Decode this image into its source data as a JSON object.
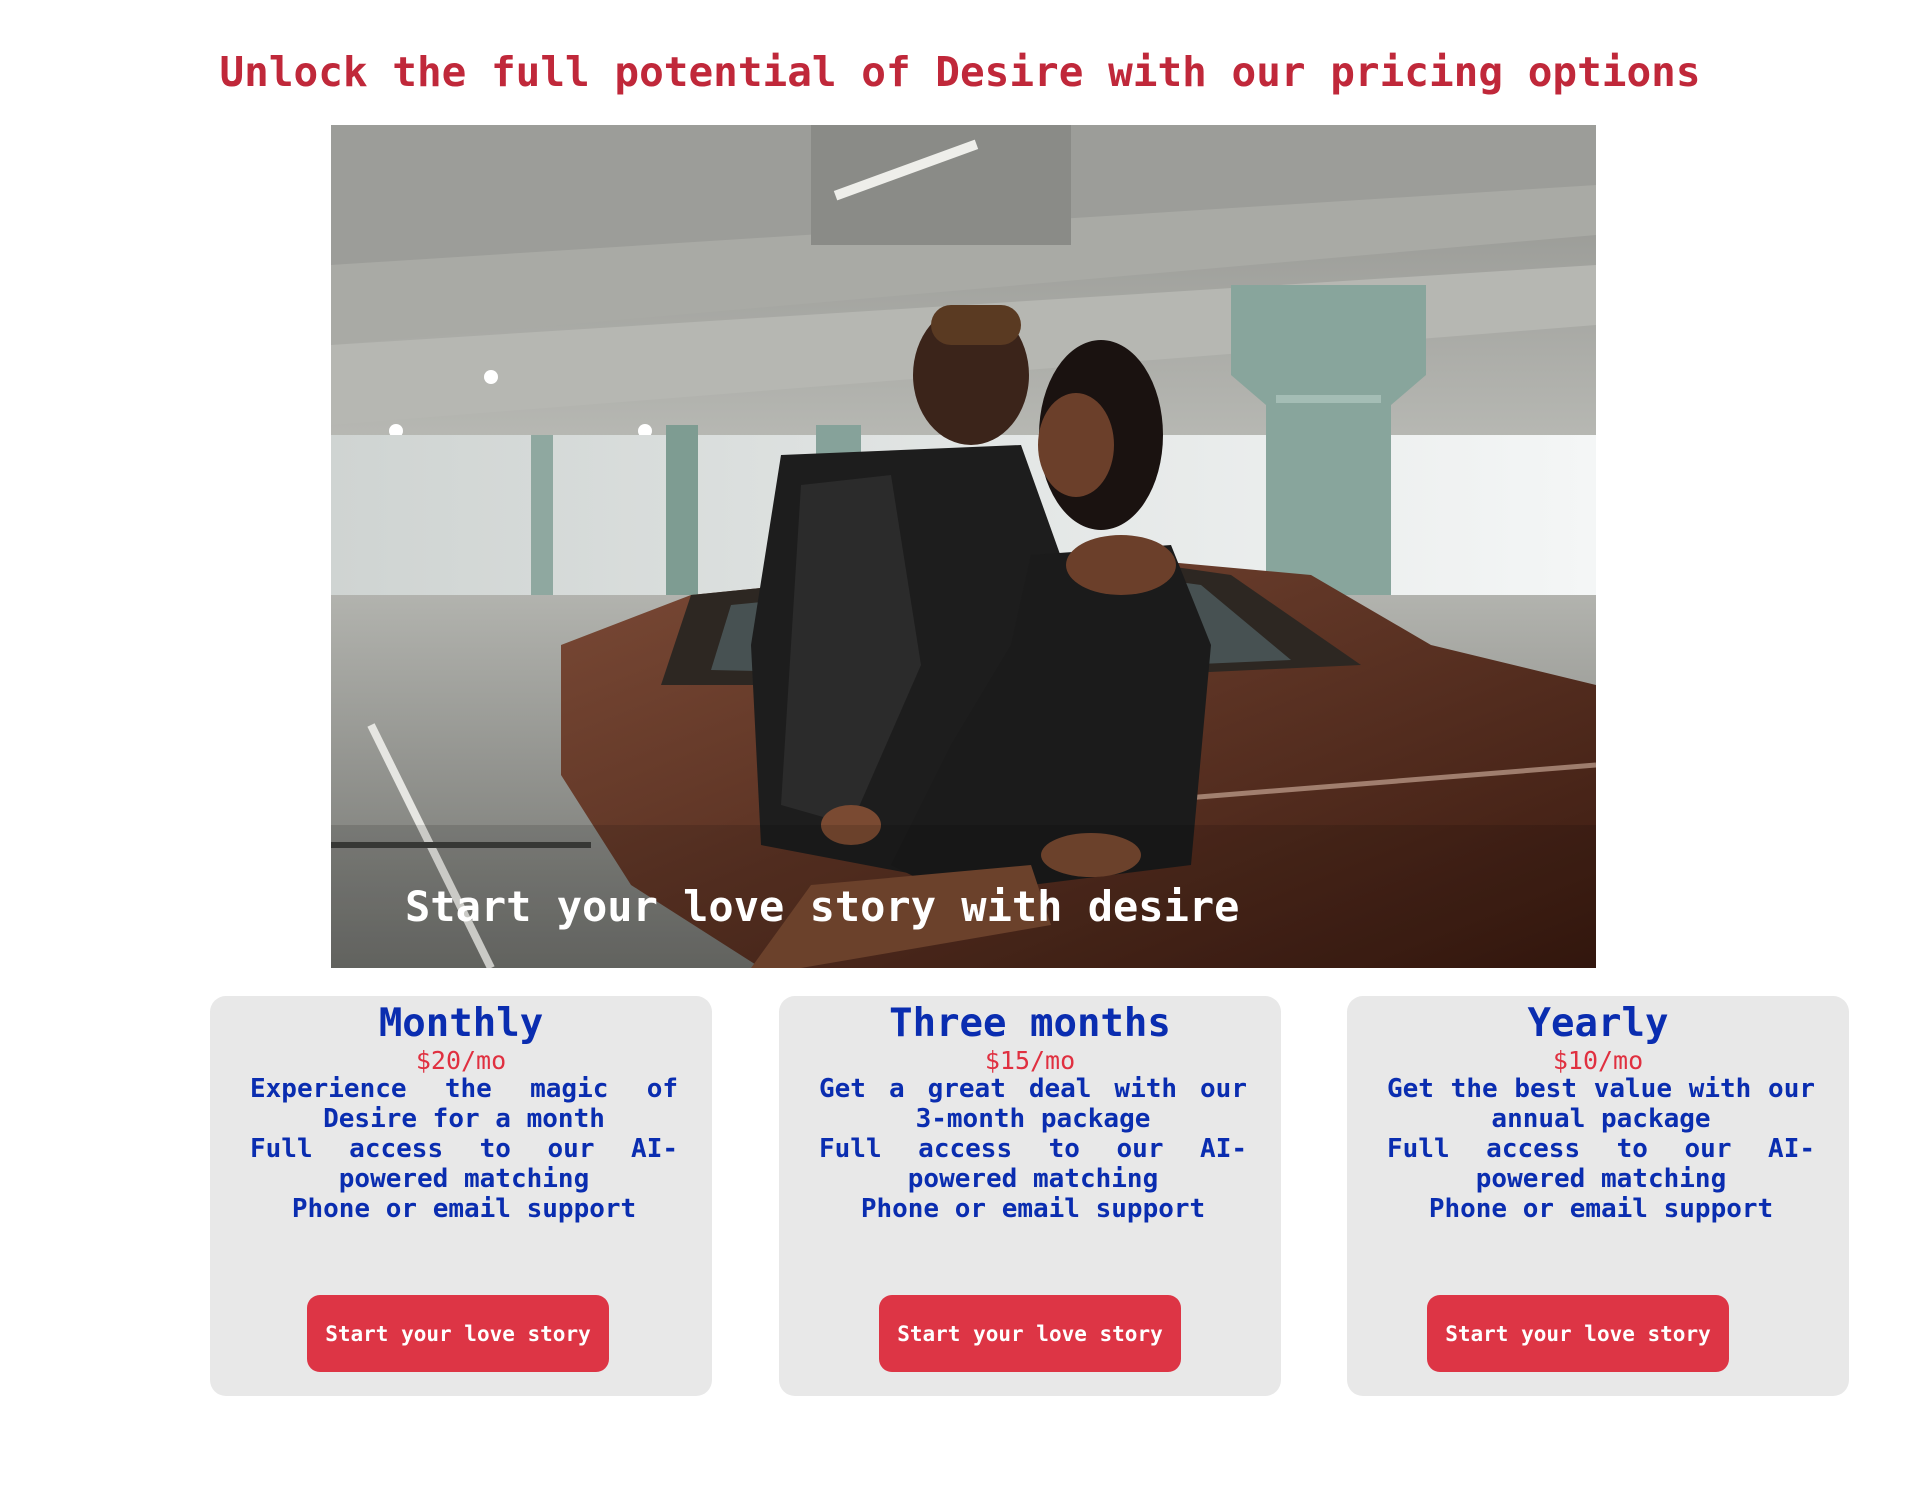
{
  "page": {
    "title": "Unlock the full potential of Desire with our pricing options"
  },
  "hero": {
    "caption": "Start your love story with desire",
    "image_description_icon": "couple-photo"
  },
  "plans": [
    {
      "name": "Monthly",
      "price": "$20/mo",
      "description": "Experience the magic of Desire for a month",
      "feature_1": "Full access to our AI-powered matching",
      "feature_2": "Phone or email support",
      "button_label": "Start your love story"
    },
    {
      "name": "Three months",
      "price": "$15/mo",
      "description": "Get a great deal with our 3-month package",
      "feature_1": "Full access to our AI-powered matching",
      "feature_2": "Phone or email support",
      "button_label": "Start your love story"
    },
    {
      "name": "Yearly",
      "price": "$10/mo",
      "description": "Get the best value with our annual package",
      "feature_1": "Full access to our AI-powered matching",
      "feature_2": "Phone or email support",
      "button_label": "Start your love story"
    }
  ],
  "colors": {
    "title": "#c0283a",
    "plan_text": "#0a2db0",
    "price": "#e03040",
    "button": "#dd3545",
    "card_bg": "#e8e8e8"
  }
}
